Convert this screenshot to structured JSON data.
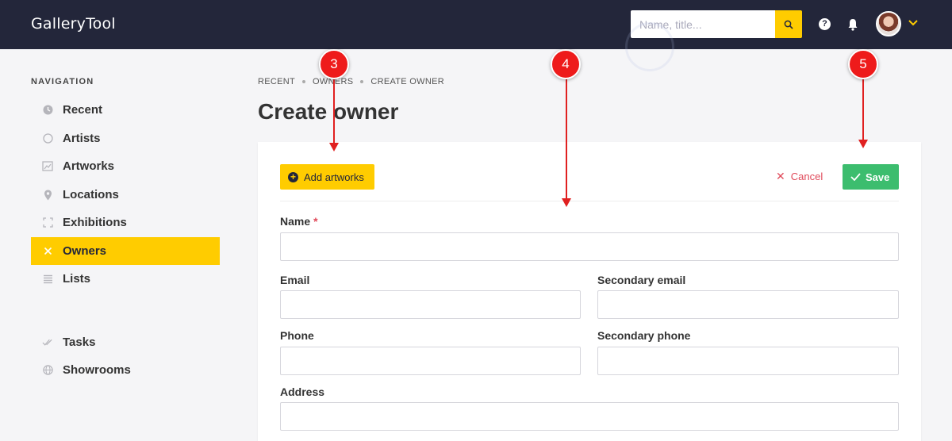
{
  "app": {
    "title": "GalleryTool"
  },
  "header": {
    "search_placeholder": "Name, title...",
    "help_label": "?"
  },
  "sidebar": {
    "heading": "NAVIGATION",
    "items": [
      {
        "label": "Recent",
        "icon": "clock-icon"
      },
      {
        "label": "Artists",
        "icon": "circle-icon"
      },
      {
        "label": "Artworks",
        "icon": "image-icon"
      },
      {
        "label": "Locations",
        "icon": "pin-icon"
      },
      {
        "label": "Exhibitions",
        "icon": "frame-icon"
      },
      {
        "label": "Owners",
        "icon": "close-icon",
        "active": true
      },
      {
        "label": "Lists",
        "icon": "list-icon"
      }
    ],
    "secondary": [
      {
        "label": "Tasks",
        "icon": "check-double-icon"
      },
      {
        "label": "Showrooms",
        "icon": "globe-icon"
      }
    ]
  },
  "breadcrumb": [
    "RECENT",
    "OWNERS",
    "CREATE OWNER"
  ],
  "page": {
    "title": "Create owner"
  },
  "toolbar": {
    "add_label": "Add artworks",
    "cancel_label": "Cancel",
    "save_label": "Save"
  },
  "form": {
    "name": {
      "label": "Name",
      "required_mark": "*",
      "value": ""
    },
    "email": {
      "label": "Email",
      "value": ""
    },
    "secondary_email": {
      "label": "Secondary email",
      "value": ""
    },
    "phone": {
      "label": "Phone",
      "value": ""
    },
    "secondary_phone": {
      "label": "Secondary phone",
      "value": ""
    },
    "address": {
      "label": "Address",
      "value": ""
    }
  },
  "annotations": [
    "3",
    "4",
    "5"
  ],
  "colors": {
    "topbar": "#23263a",
    "accent": "#ffcc00",
    "save": "#3cbd6e",
    "cancel": "#e04a5a",
    "annotation": "#ee1b1b"
  }
}
